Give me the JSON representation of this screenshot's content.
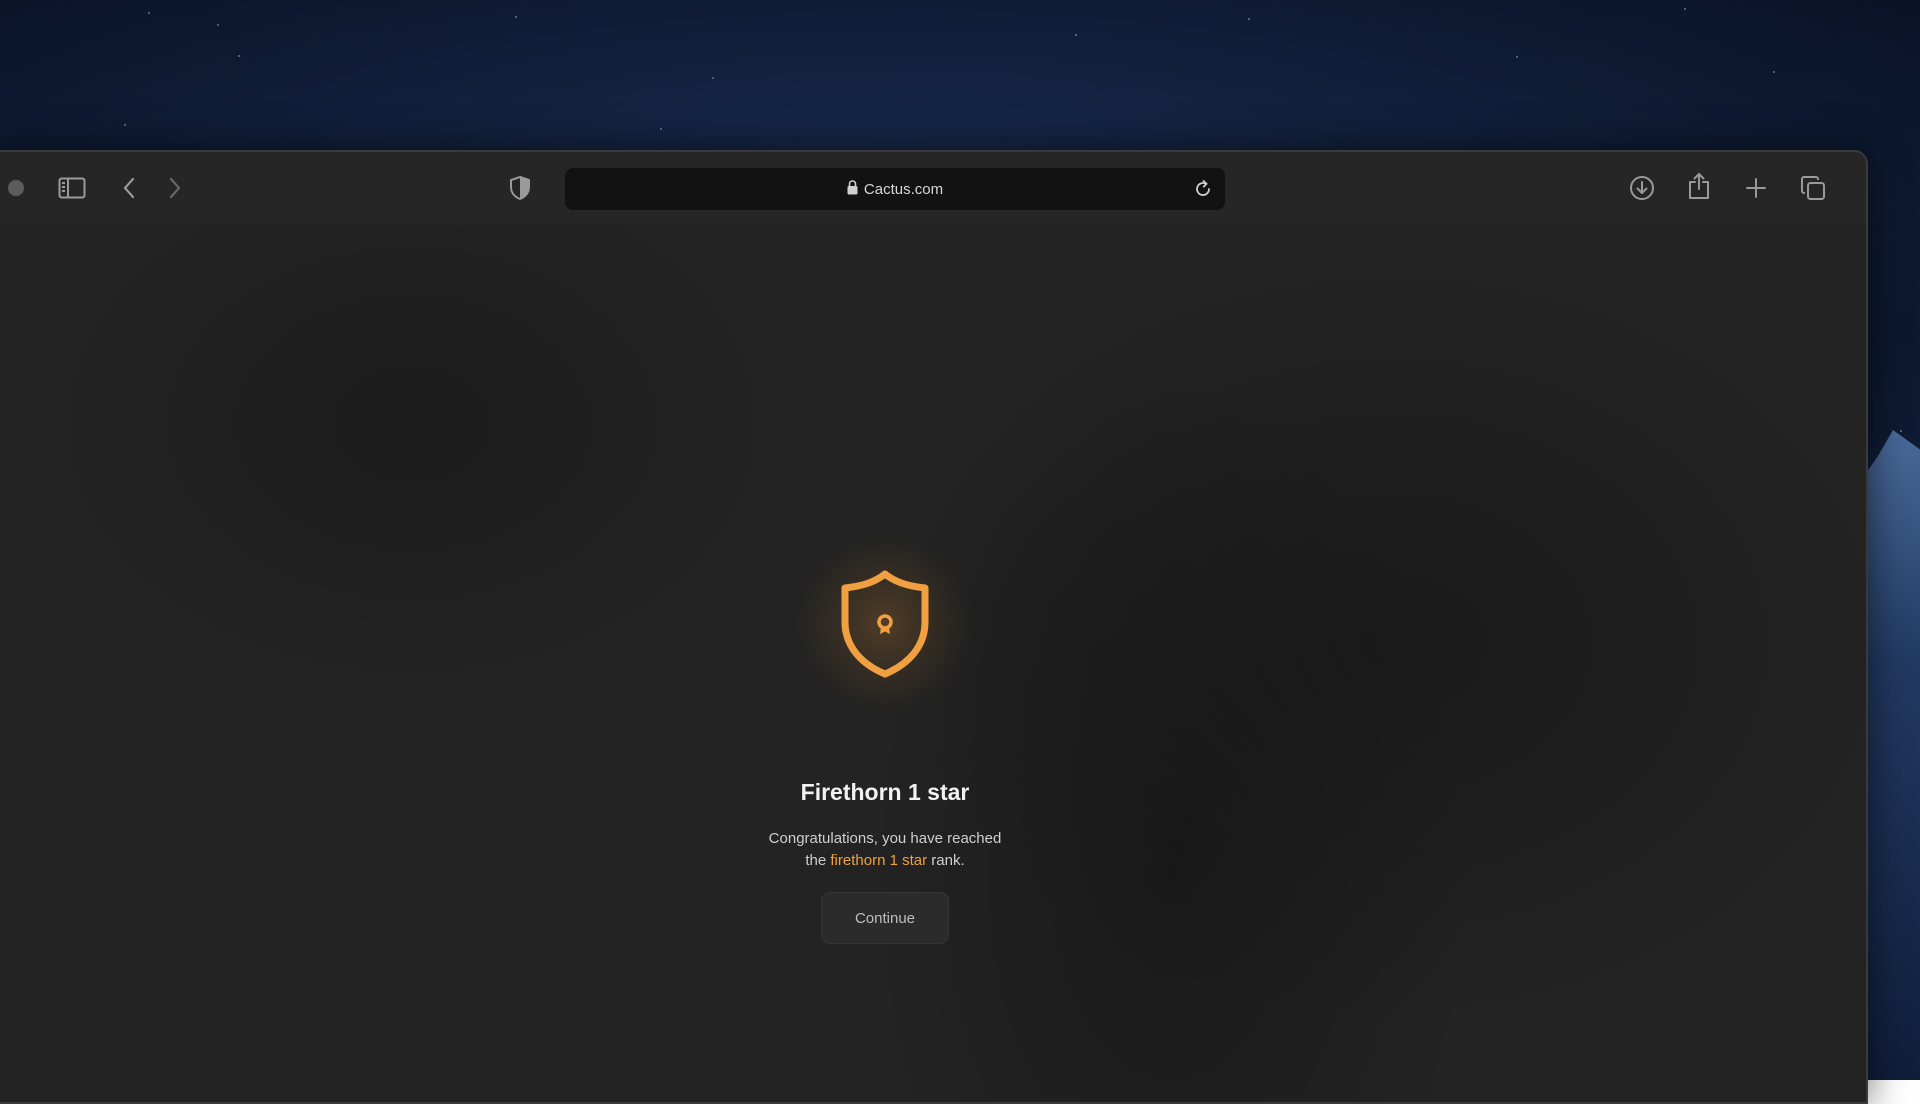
{
  "browser": {
    "url": "Cactus.com",
    "icons": {
      "window_dot": "window-control-dot",
      "sidebar": "sidebar-toggle-icon",
      "back": "chevron-left-icon",
      "forward": "chevron-right-icon",
      "shield": "privacy-shield-icon",
      "lock": "lock-icon",
      "reload": "reload-icon",
      "download": "download-icon",
      "share": "share-icon",
      "new_tab": "plus-icon",
      "tab_overview": "tabs-overview-icon"
    }
  },
  "rank_modal": {
    "icon": "rank-shield-badge-icon",
    "title": "Firethorn 1 star",
    "message_line1": "Congratulations, you have reached",
    "message_prefix": "the",
    "message_highlight": "firethorn 1 star",
    "message_suffix": "rank.",
    "button_label": "Continue"
  },
  "colors": {
    "accent": "#f0a040",
    "background": "#232323",
    "toolbar": "#262626",
    "address_bar": "#121212"
  }
}
